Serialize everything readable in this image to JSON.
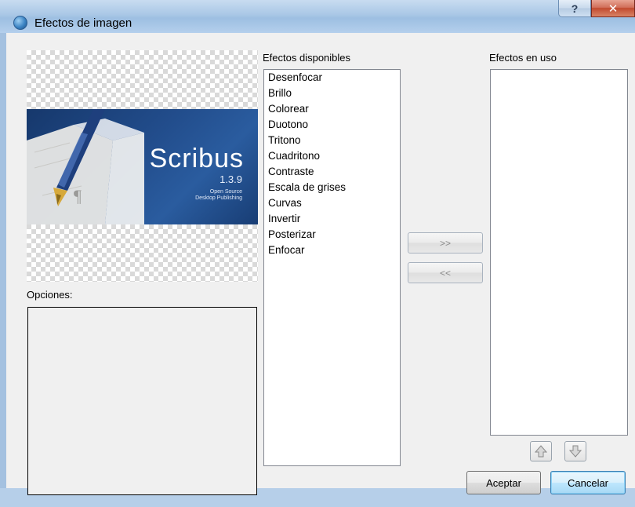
{
  "window": {
    "title": "Efectos de imagen",
    "help_glyph": "?",
    "close_glyph": "✕"
  },
  "preview": {
    "splash_product": "Scribus",
    "splash_version": "1.3.9",
    "splash_tagline_1": "Open Source",
    "splash_tagline_2": "Desktop Publishing"
  },
  "options": {
    "label": "Opciones:"
  },
  "available": {
    "label": "Efectos disponibles",
    "items": [
      "Desenfocar",
      "Brillo",
      "Colorear",
      "Duotono",
      "Tritono",
      "Cuadritono",
      "Contraste",
      "Escala de grises",
      "Curvas",
      "Invertir",
      "Posterizar",
      "Enfocar"
    ]
  },
  "in_use": {
    "label": "Efectos en uso",
    "items": []
  },
  "buttons": {
    "add": ">>",
    "remove": "<<",
    "ok": "Aceptar",
    "cancel": "Cancelar"
  },
  "icons": {
    "move_up": "up-arrow-icon",
    "move_down": "down-arrow-icon"
  },
  "colors": {
    "splash_blue": "#224d8c",
    "default_button": "#bee6fd"
  }
}
